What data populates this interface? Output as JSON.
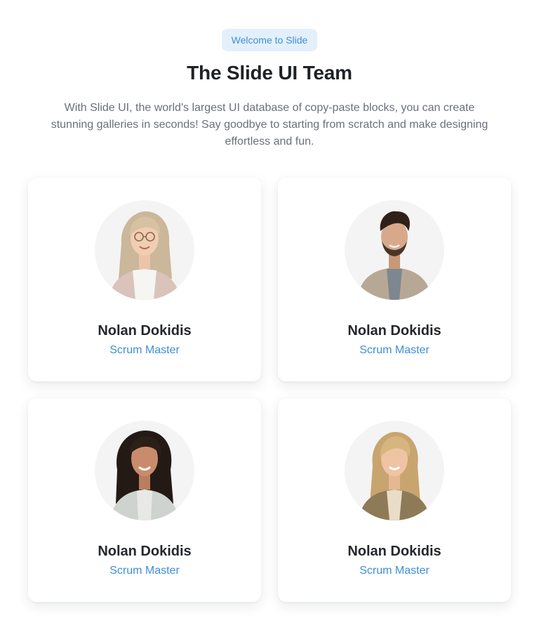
{
  "hero": {
    "badge": "Welcome to Slide",
    "title": "The Slide UI Team",
    "description": "With Slide UI, the world's largest UI database of copy-paste blocks, you can create stunning galleries in seconds! Say goodbye to starting from scratch and make designing effortless and fun."
  },
  "team": [
    {
      "name": "Nolan Dokidis",
      "role": "Scrum Master",
      "photo_icon": "woman-glasses-portrait"
    },
    {
      "name": "Nolan Dokidis",
      "role": "Scrum Master",
      "photo_icon": "man-jacket-portrait"
    },
    {
      "name": "Nolan Dokidis",
      "role": "Scrum Master",
      "photo_icon": "woman-curly-hair-portrait"
    },
    {
      "name": "Nolan Dokidis",
      "role": "Scrum Master",
      "photo_icon": "woman-blonde-portrait"
    }
  ],
  "colors": {
    "accent": "#3e8fd6",
    "badge_bg": "#e3f0fb",
    "avatar_bg": "#f4f4f5"
  }
}
